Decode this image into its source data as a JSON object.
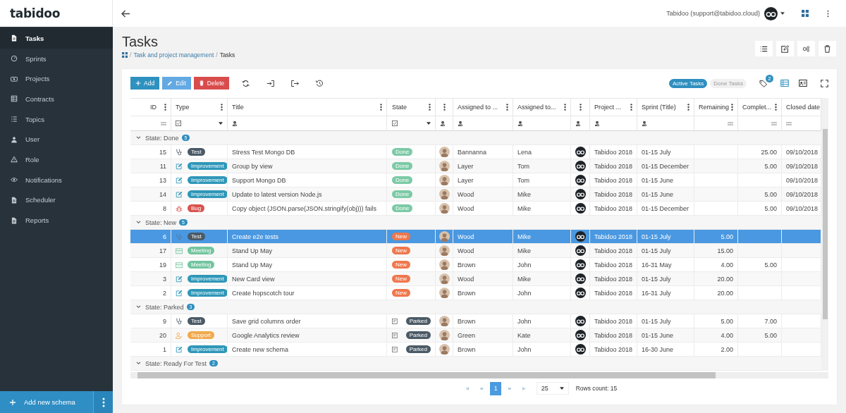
{
  "app": {
    "logo": "tabidoo"
  },
  "sidebar": {
    "items": [
      {
        "label": "Tasks",
        "kind": "document",
        "selected": true
      },
      {
        "label": "Sprints",
        "kind": "gauge",
        "selected": false
      },
      {
        "label": "Projects",
        "kind": "wallet",
        "selected": false
      },
      {
        "label": "Contracts",
        "kind": "table",
        "selected": false
      },
      {
        "label": "Topics",
        "kind": "list",
        "selected": false
      },
      {
        "label": "User",
        "kind": "user",
        "selected": false
      },
      {
        "label": "Role",
        "kind": "warning",
        "selected": false
      },
      {
        "label": "Notifications",
        "kind": "eye",
        "selected": false
      },
      {
        "label": "Scheduler",
        "kind": "document",
        "selected": false
      },
      {
        "label": "Reports",
        "kind": "document",
        "selected": false
      }
    ],
    "add_button": "Add new schema"
  },
  "header": {
    "user": "Tabidoo (support@tabidoo.cloud)"
  },
  "page": {
    "title": "Tasks",
    "breadcrumb": [
      "Task and project management",
      "Tasks"
    ],
    "separator": "/"
  },
  "toolbar": {
    "buttons": [
      {
        "label": "Add",
        "kind": "add"
      },
      {
        "label": "Edit",
        "kind": "edit"
      },
      {
        "label": "Delete",
        "kind": "delete"
      }
    ],
    "filters": [
      {
        "label": "Active Tasks",
        "selected": true
      },
      {
        "label": "Done Tasks",
        "selected": false
      }
    ],
    "tag_count": "2",
    "views": [
      {
        "kind": "grid",
        "selected": true
      },
      {
        "kind": "card",
        "selected": false
      }
    ]
  },
  "table": {
    "columns": [
      {
        "label": "ID",
        "kind": "equals"
      },
      {
        "label": "Type",
        "kind": "list"
      },
      {
        "label": "Title",
        "kind": "text"
      },
      {
        "label": "State",
        "kind": "list"
      },
      {
        "kind": "text"
      },
      {
        "label": "Assigned to ...",
        "kind": "text"
      },
      {
        "label": "Assigned to...",
        "kind": "text"
      },
      {
        "kind": "text"
      },
      {
        "label": "Project ...",
        "kind": "text"
      },
      {
        "label": "Sprint (Title)",
        "kind": "text"
      },
      {
        "label": "Remaining",
        "kind": "equals"
      },
      {
        "label": "Complet...",
        "kind": "equals"
      },
      {
        "label": "Closed date",
        "kind": "equals"
      }
    ],
    "groups": [
      {
        "label": "State: Done",
        "count": "5",
        "expanded": true,
        "rows": [
          {
            "id": "15",
            "type": {
              "label": "Test",
              "kind": "test",
              "color": "#4b5a66"
            },
            "title": "Stress Test Mongo DB",
            "state": {
              "label": "Done",
              "color": "#7ccaa6"
            },
            "assigned_to": "Bannanna",
            "assigned_to_2": "Lena",
            "project": "Tabidoo 2018",
            "sprint": "01-15 July",
            "completed": "25.00",
            "closed_date": "09/10/2018",
            "selected": false
          },
          {
            "id": "11",
            "type": {
              "label": "Improvement",
              "kind": "improvement",
              "color": "#2f97b8"
            },
            "title": "Group by view",
            "state": {
              "label": "Done",
              "color": "#7ccaa6"
            },
            "assigned_to": "Layer",
            "assigned_to_2": "Tom",
            "project": "Tabidoo 2018",
            "sprint": "01-15 December",
            "completed": "5.00",
            "closed_date": "09/10/2018",
            "selected": false
          },
          {
            "id": "13",
            "type": {
              "label": "Improvement",
              "kind": "improvement",
              "color": "#2f97b8"
            },
            "title": "Support Mongo DB",
            "state": {
              "label": "Done",
              "color": "#7ccaa6"
            },
            "assigned_to": "Layer",
            "assigned_to_2": "Tom",
            "project": "Tabidoo 2018",
            "sprint": "01-15 June",
            "closed_date": "09/10/2018",
            "selected": false
          },
          {
            "id": "14",
            "type": {
              "label": "Improvement",
              "kind": "improvement",
              "color": "#2f97b8"
            },
            "title": "Update to latest version Node.js",
            "state": {
              "label": "Done",
              "color": "#7ccaa6"
            },
            "assigned_to": "Wood",
            "assigned_to_2": "Mike",
            "project": "Tabidoo 2018",
            "sprint": "01-15 June",
            "completed": "5.00",
            "closed_date": "09/10/2018",
            "selected": false
          },
          {
            "id": "8",
            "type": {
              "label": "Bug",
              "kind": "bug",
              "color": "#d9534f"
            },
            "title": "Copy object (JSON.parse(JSON.stringify(obj))) fails",
            "state": {
              "label": "Done",
              "color": "#7ccaa6"
            },
            "assigned_to": "Wood",
            "assigned_to_2": "Mike",
            "project": "Tabidoo 2018",
            "sprint": "01-15 December",
            "completed": "5.00",
            "closed_date": "09/10/2018",
            "selected": false
          }
        ]
      },
      {
        "label": "State: New",
        "count": "5",
        "expanded": true,
        "rows": [
          {
            "id": "6",
            "type": {
              "label": "Test",
              "kind": "test",
              "color": "#4b5a66"
            },
            "title": "Create e2e tests",
            "state": {
              "label": "New",
              "color": "#f0774d"
            },
            "assigned_to": "Wood",
            "assigned_to_2": "Mike",
            "project": "Tabidoo 2018",
            "sprint": "01-15 July",
            "remaining": "5.00",
            "selected": true
          },
          {
            "id": "17",
            "type": {
              "label": "Meeting",
              "kind": "meeting",
              "color": "#72c59f"
            },
            "title": "Stand Up May",
            "state": {
              "label": "New",
              "color": "#f0774d"
            },
            "assigned_to": "Wood",
            "assigned_to_2": "Mike",
            "project": "Tabidoo 2018",
            "sprint": "01-15 July",
            "remaining": "15.00",
            "selected": false
          },
          {
            "id": "19",
            "type": {
              "label": "Meeting",
              "kind": "meeting",
              "color": "#72c59f"
            },
            "title": "Stand Up May",
            "state": {
              "label": "New",
              "color": "#f0774d"
            },
            "assigned_to": "Brown",
            "assigned_to_2": "John",
            "project": "Tabidoo 2018",
            "sprint": "16-31 May",
            "remaining": "4.00",
            "completed": "5.00",
            "selected": false
          },
          {
            "id": "3",
            "type": {
              "label": "Improvement",
              "kind": "improvement",
              "color": "#2f97b8"
            },
            "title": "New Card view",
            "state": {
              "label": "New",
              "color": "#f0774d"
            },
            "assigned_to": "Wood",
            "assigned_to_2": "Mike",
            "project": "Tabidoo 2018",
            "sprint": "01-15 July",
            "remaining": "20.00",
            "selected": false
          },
          {
            "id": "2",
            "type": {
              "label": "Improvement",
              "kind": "improvement",
              "color": "#2f97b8"
            },
            "title": "Create hopscotch tour",
            "state": {
              "label": "New",
              "color": "#f0774d"
            },
            "assigned_to": "Brown",
            "assigned_to_2": "John",
            "project": "Tabidoo 2018",
            "sprint": "16-31 July",
            "remaining": "20.00",
            "selected": false
          }
        ]
      },
      {
        "label": "State: Parked",
        "count": "3",
        "expanded": true,
        "rows": [
          {
            "id": "9",
            "type": {
              "label": "Test",
              "kind": "test",
              "color": "#4b5a66"
            },
            "title": "Save grid columns order",
            "state": {
              "label": "Parked",
              "color": "#4b5a66",
              "note": true
            },
            "assigned_to": "Brown",
            "assigned_to_2": "John",
            "project": "Tabidoo 2018",
            "sprint": "01-15 July",
            "remaining": "5.00",
            "completed": "7.00",
            "selected": false
          },
          {
            "id": "20",
            "type": {
              "label": "Support",
              "kind": "support",
              "color": "#f2a94c"
            },
            "title": "Google Analytics review",
            "state": {
              "label": "Parked",
              "color": "#4b5a66",
              "note": true
            },
            "assigned_to": "Green",
            "assigned_to_2": "Kate",
            "project": "Tabidoo 2018",
            "sprint": "01-15 June",
            "remaining": "4.00",
            "completed": "5.00",
            "selected": false
          },
          {
            "id": "1",
            "type": {
              "label": "Improvement",
              "kind": "improvement",
              "color": "#2f97b8"
            },
            "title": "Create new schema",
            "state": {
              "label": "Parked",
              "color": "#4b5a66",
              "note": true
            },
            "assigned_to": "Brown",
            "assigned_to_2": "John",
            "project": "Tabidoo 2018",
            "sprint": "16-30 June",
            "remaining": "2.00",
            "selected": false
          }
        ]
      },
      {
        "label": "State: Ready For Test",
        "count": "2",
        "expanded": true
      }
    ]
  },
  "pager": {
    "pages": [
      {
        "label": "1",
        "selected": true
      }
    ],
    "page_size": "25",
    "rows_count": "Rows count: 15"
  }
}
